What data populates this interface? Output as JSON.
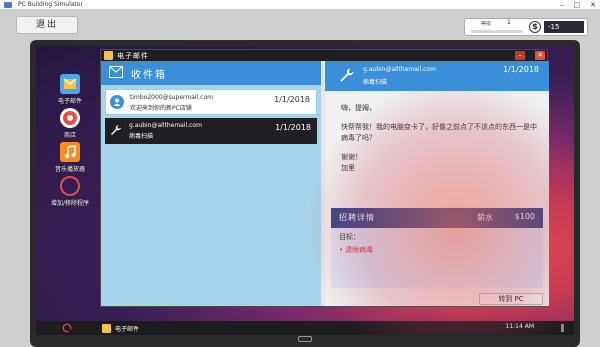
{
  "host_window": {
    "title": "PC Building Simulator",
    "controls": [
      "–",
      "□",
      "✕"
    ]
  },
  "hud": {
    "quit_label": "退出",
    "level_label": "等级",
    "level_value": "1",
    "level_progress": 0.0,
    "money_symbol": "$",
    "money_value": "-15"
  },
  "desktop": {
    "icons": [
      {
        "name": "mail",
        "label": "电子邮件"
      },
      {
        "name": "shop",
        "label": "商店"
      },
      {
        "name": "music",
        "label": "音乐播放器"
      },
      {
        "name": "add-remove",
        "label": "增加/移除程序"
      }
    ]
  },
  "email_window": {
    "title": "电子邮件",
    "min_label": "–",
    "close_label": "✕",
    "inbox": {
      "title": "收件箱",
      "messages": [
        {
          "from": "timbo2000@supermail.com",
          "subject": "欢迎来到你的新PC店铺",
          "date": "1/1/2018",
          "selected": false
        },
        {
          "from": "g.aubin@allthemail.com",
          "subject": "病毒扫描",
          "date": "1/1/2018",
          "selected": true
        }
      ]
    },
    "reader": {
      "from": "g.aubin@allthemail.com",
      "subject": "病毒扫描",
      "date": "1/1/2018",
      "greeting": "嗨，提姆，",
      "body": "快帮帮我！我的电脑变卡了，好像之前点了不该点的东西一是中病毒了吗？",
      "signoff_1": "谢谢！",
      "signoff_2": "加里",
      "job": {
        "title": "招聘详情",
        "pay_label": "薪水",
        "pay": "$100",
        "goal_label": "目标：",
        "goals": [
          "清除病毒"
        ]
      },
      "goto_label": "转到 PC"
    }
  },
  "taskbar": {
    "app_label": "电子邮件",
    "clock": "11:14 AM"
  },
  "colors": {
    "accent_blue": "#3a8fd8",
    "inbox_bg": "#a5d4ec",
    "job_bar": "#2f4a8a",
    "goal_red": "#d63030"
  }
}
